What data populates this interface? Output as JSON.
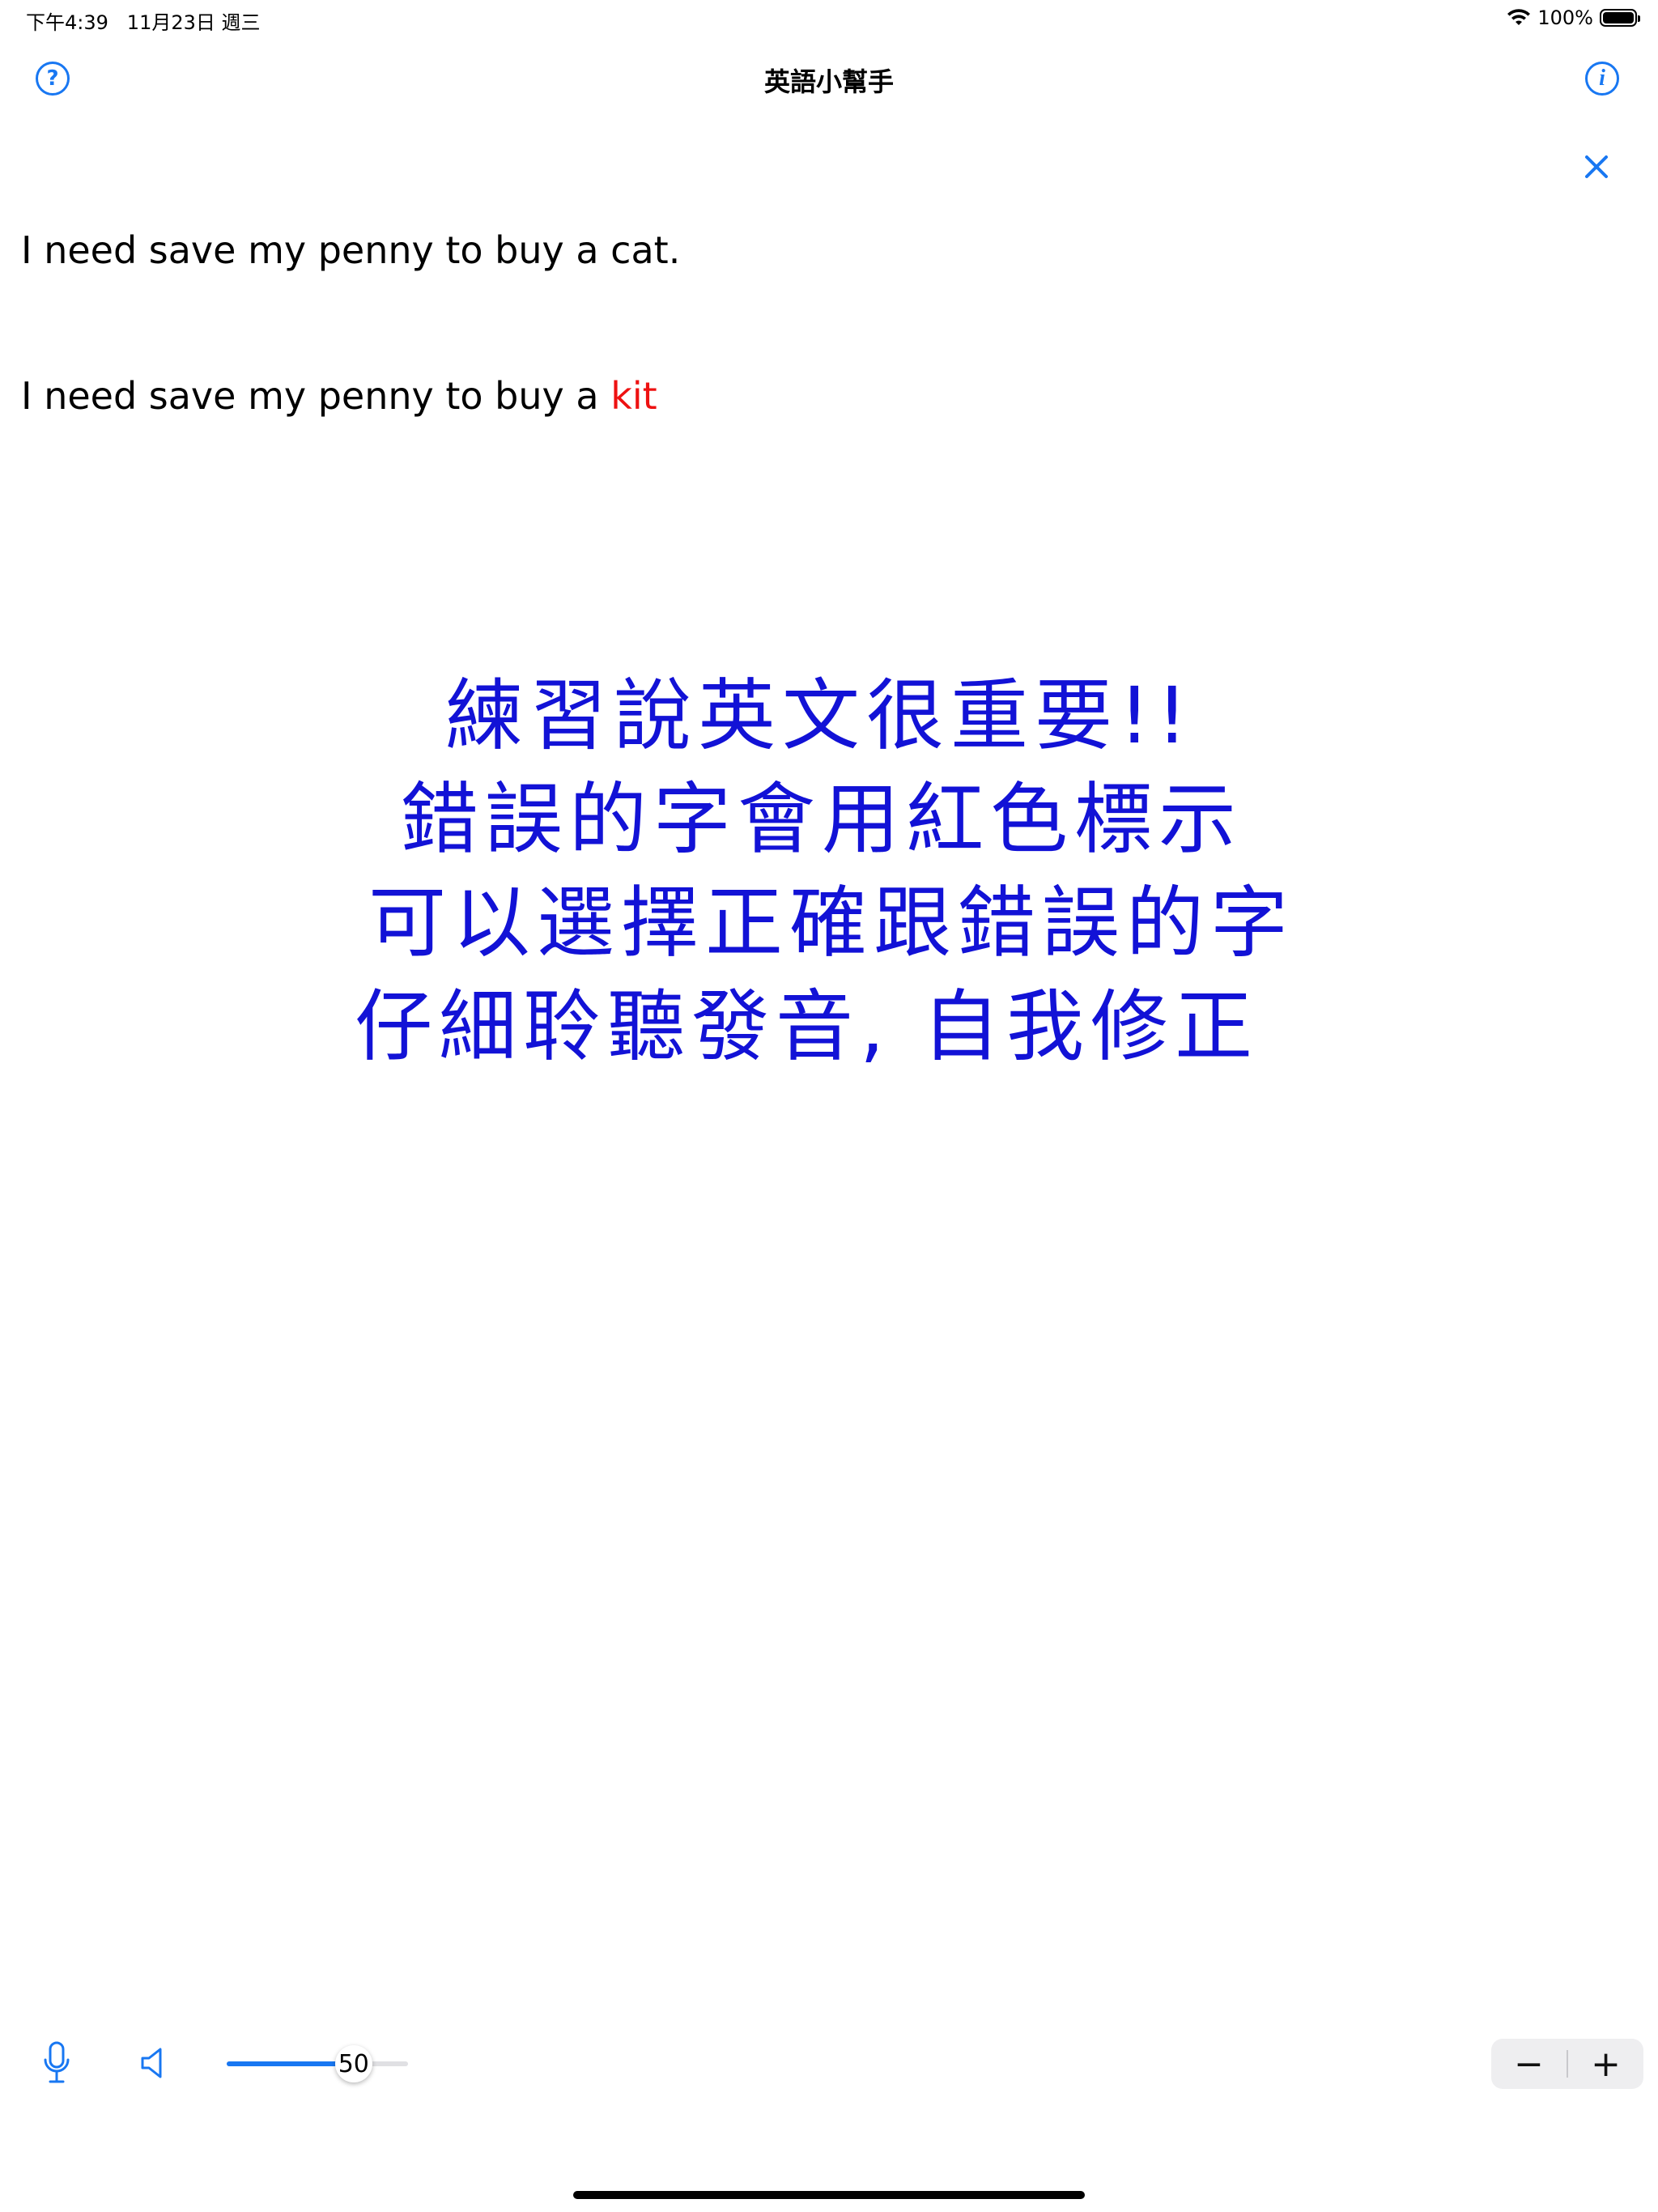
{
  "status_bar": {
    "time": "下午4:39",
    "date": "11月23日 週三",
    "battery_text": "100%",
    "battery_level": 1.0,
    "wifi_icon": "wifi-icon",
    "battery_icon": "battery-icon"
  },
  "nav": {
    "title": "英語小幫手",
    "help_icon": "?",
    "info_icon": "i"
  },
  "sentences": {
    "correct": "I need save my penny to buy a cat.",
    "spoken_prefix": "I need save my penny to buy a ",
    "spoken_wrong_word": "kit"
  },
  "instructions": {
    "line1": "練習說英文很重要!!",
    "line2": "錯誤的字會用紅色標示",
    "line3": "可以選擇正確跟錯誤的字",
    "line4": "仔細聆聽發音, 自我修正"
  },
  "toolbar": {
    "slider_value": "50",
    "slider_fraction": 0.7,
    "stepper_minus": "−",
    "stepper_plus": "+"
  },
  "colors": {
    "accent": "#1877f2",
    "error": "#ee1111",
    "instruction_text": "#1212d6"
  }
}
